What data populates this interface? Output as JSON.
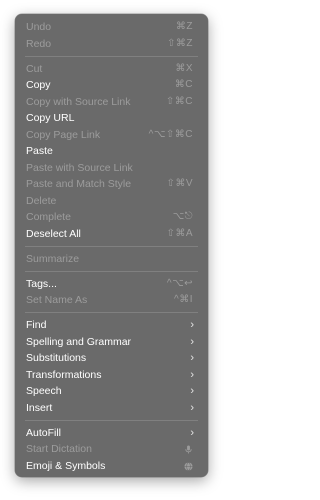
{
  "menu": {
    "undo": {
      "label": "Undo",
      "shortcut": "⌘Z"
    },
    "redo": {
      "label": "Redo",
      "shortcut": "⇧⌘Z"
    },
    "cut": {
      "label": "Cut",
      "shortcut": "⌘X"
    },
    "copy": {
      "label": "Copy",
      "shortcut": "⌘C"
    },
    "copy_source_link": {
      "label": "Copy with Source Link",
      "shortcut": "⇧⌘C"
    },
    "copy_url": {
      "label": "Copy URL"
    },
    "copy_page_link": {
      "label": "Copy Page Link",
      "shortcut": "^⌥⇧⌘C"
    },
    "paste": {
      "label": "Paste"
    },
    "paste_source_link": {
      "label": "Paste with Source Link"
    },
    "paste_match_style": {
      "label": "Paste and Match Style",
      "shortcut": "⇧⌘V"
    },
    "delete": {
      "label": "Delete"
    },
    "complete": {
      "label": "Complete",
      "shortcut": "⌥⎋"
    },
    "deselect_all": {
      "label": "Deselect All",
      "shortcut": "⇧⌘A"
    },
    "summarize": {
      "label": "Summarize"
    },
    "tags": {
      "label": "Tags...",
      "shortcut": "^⌥↩"
    },
    "set_name_as": {
      "label": "Set Name As",
      "shortcut": "^⌘I"
    },
    "find": {
      "label": "Find"
    },
    "spelling": {
      "label": "Spelling and Grammar"
    },
    "substitutions": {
      "label": "Substitutions"
    },
    "transformations": {
      "label": "Transformations"
    },
    "speech": {
      "label": "Speech"
    },
    "insert": {
      "label": "Insert"
    },
    "autofill": {
      "label": "AutoFill"
    },
    "start_dictation": {
      "label": "Start Dictation",
      "icon": "microphone-icon"
    },
    "emoji_symbols": {
      "label": "Emoji & Symbols",
      "icon": "globe-icon"
    },
    "submenu_icon": "›"
  },
  "colors": {
    "menu_background": "#6a6a6a",
    "enabled_text": "#ffffff",
    "disabled_text": "#9c9c9c"
  }
}
